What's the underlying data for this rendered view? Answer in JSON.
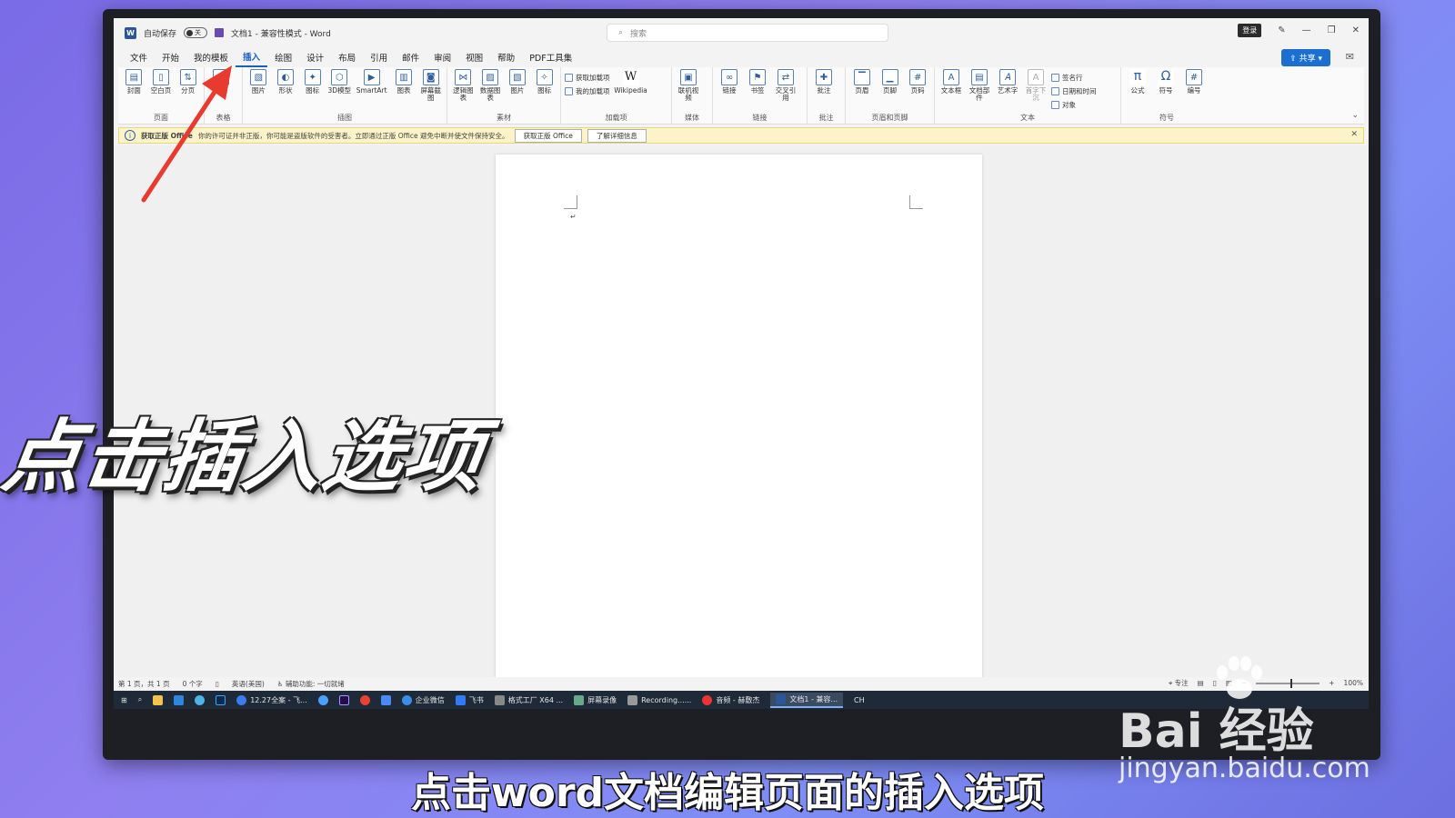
{
  "titlebar": {
    "autosave_label": "自动保存",
    "autosave_state": "关",
    "doc_title": "文档1 - 兼容性模式 - Word",
    "search_placeholder": "搜索",
    "login": "登录"
  },
  "menu": {
    "items": [
      "文件",
      "开始",
      "我的模板",
      "插入",
      "绘图",
      "设计",
      "布局",
      "引用",
      "邮件",
      "审阅",
      "视图",
      "帮助",
      "PDF工具集"
    ],
    "active": "插入",
    "share": "共享"
  },
  "ribbon": {
    "groups": [
      {
        "label": "页面",
        "buttons": [
          "封面",
          "空白页",
          "分页"
        ]
      },
      {
        "label": "表格",
        "buttons": [
          "表格"
        ]
      },
      {
        "label": "插图",
        "buttons": [
          "图片",
          "形状",
          "图标",
          "3D模型",
          "SmartArt",
          "图表",
          "屏幕截图"
        ]
      },
      {
        "label": "素材",
        "buttons": [
          "逻辑图表",
          "数据图表",
          "图片",
          "图标"
        ]
      },
      {
        "label": "加载项",
        "small": [
          "获取加载项",
          "我的加载项"
        ],
        "buttons": [
          "Wikipedia"
        ]
      },
      {
        "label": "媒体",
        "buttons": [
          "联机视频"
        ]
      },
      {
        "label": "链接",
        "buttons": [
          "链接",
          "书签",
          "交叉引用"
        ]
      },
      {
        "label": "批注",
        "buttons": [
          "批注"
        ]
      },
      {
        "label": "页眉和页脚",
        "buttons": [
          "页眉",
          "页脚",
          "页码"
        ]
      },
      {
        "label": "文本",
        "buttons": [
          "文本框",
          "文档部件",
          "艺术字",
          "首字下沉"
        ],
        "small": [
          "签名行",
          "日期和时间",
          "对象"
        ]
      },
      {
        "label": "符号",
        "buttons": [
          "公式",
          "符号",
          "编号"
        ]
      }
    ]
  },
  "warning": {
    "title": "获取正版 Office",
    "message": "你的许可证并非正版，你可能是盗版软件的受害者。立即通过正版 Office 避免中断并使文件保持安全。",
    "btn_get": "获取正版 Office",
    "btn_more": "了解详细信息"
  },
  "status": {
    "page": "第 1 页，共 1 页",
    "words": "0 个字",
    "language": "英语(美国)",
    "accessibility": "辅助功能: 一切就绪",
    "focus": "专注",
    "zoom": "100%"
  },
  "taskbar": {
    "items": [
      "12.27全案 - 飞...",
      "企业微信",
      "飞书",
      "格式工厂 X64 ...",
      "屏幕录像",
      "Recording......",
      "音频 - 赫敷杰",
      "文档1 - 兼容..."
    ],
    "active_index": 7,
    "ime": "CH"
  },
  "overlay": {
    "big_caption": "点击插入选项",
    "subtitle": "点击word文档编辑页面的插入选项",
    "watermark_logo": "Bai 经验",
    "watermark_url": "jingyan.baidu.com"
  },
  "colors": {
    "accent": "#1b5fc1",
    "arrow": "#e83a2e",
    "warn_bg": "#fcf3c9"
  }
}
